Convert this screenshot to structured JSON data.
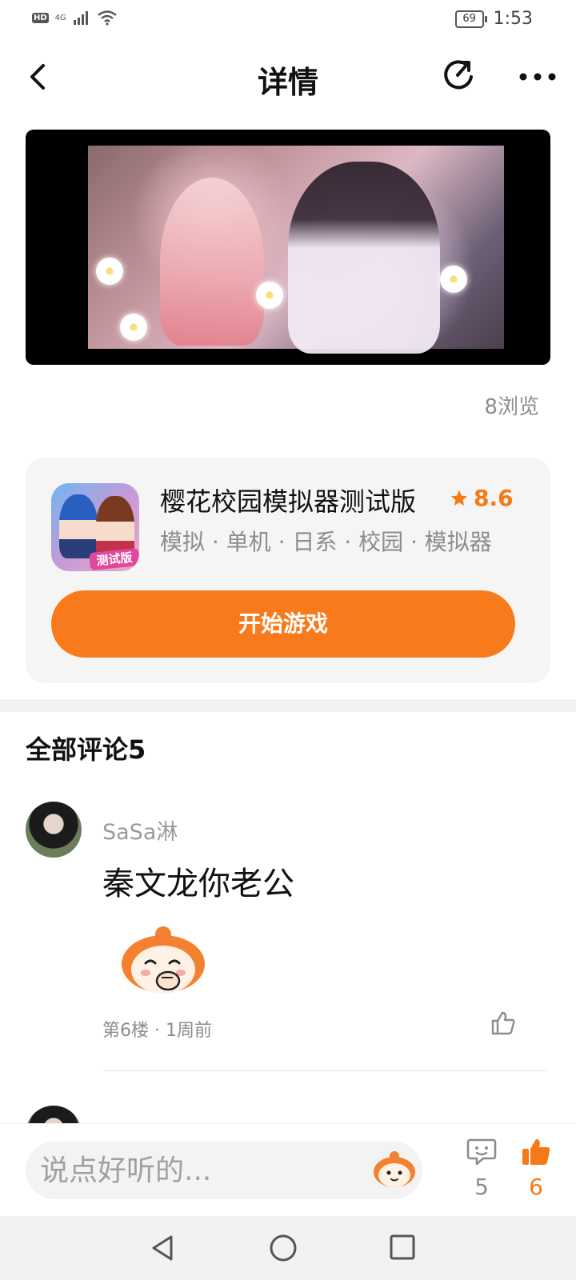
{
  "status_bar": {
    "hd_label": "HD",
    "network_label": "4G",
    "battery_level": "69",
    "time": "1:53"
  },
  "header": {
    "title": "详情",
    "icons": {
      "back": "back-arrow-icon",
      "share": "share-icon",
      "more": "more-dots-icon"
    }
  },
  "video": {
    "views": "8浏览"
  },
  "game": {
    "title": "樱花校园模拟器测试版",
    "rating": "8.6",
    "tags": "模拟 · 单机 · 日系 · 校园 · 模拟器",
    "icon_badge": "测试版",
    "play_button": "开始游戏",
    "accent_color": "#f97a1a"
  },
  "comments": {
    "heading": "全部评论5",
    "items": [
      {
        "user": "SaSa淋",
        "text": "秦文龙你老公",
        "meta": "第6楼 · 1周前"
      }
    ]
  },
  "bottom_bar": {
    "input_placeholder": "说点好听的...",
    "comment_count": "5",
    "like_count": "6",
    "like_color": "#f57a15"
  },
  "system_nav": {
    "icons": [
      "nav-back-icon",
      "nav-home-icon",
      "nav-recents-icon"
    ]
  }
}
